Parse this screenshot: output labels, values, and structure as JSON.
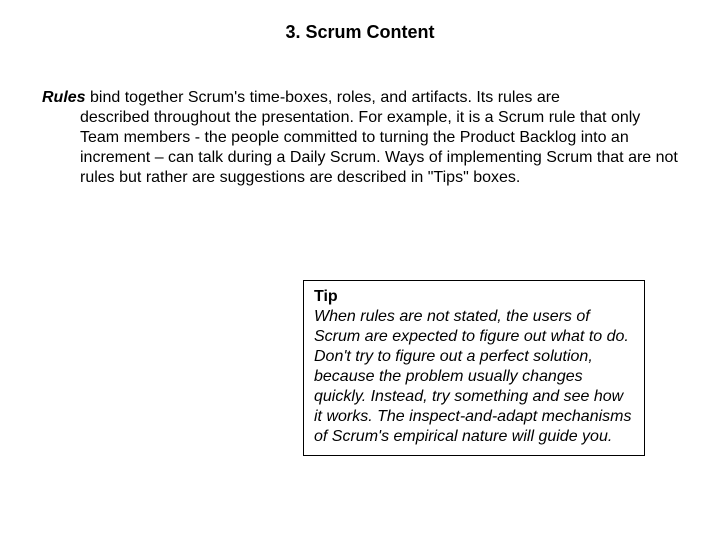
{
  "heading": "3. Scrum Content",
  "paragraph": {
    "lead": "Rules",
    "first_line_rest": " bind together Scrum's time-boxes, roles, and artifacts. Its rules are",
    "rest": "described throughout the presentation. For example, it is a Scrum rule that only Team members - the people committed to turning the Product Backlog into an increment – can talk during a Daily Scrum. Ways of implementing Scrum that are not rules but rather are suggestions are described in \"Tips\" boxes."
  },
  "tip": {
    "title": "Tip",
    "body": "When rules are not stated, the users of Scrum are expected to figure out what to do. Don't try to figure out a perfect solution, because the problem usually changes quickly. Instead, try something and see how it works. The inspect-and-adapt mechanisms of Scrum's empirical nature will guide you."
  }
}
